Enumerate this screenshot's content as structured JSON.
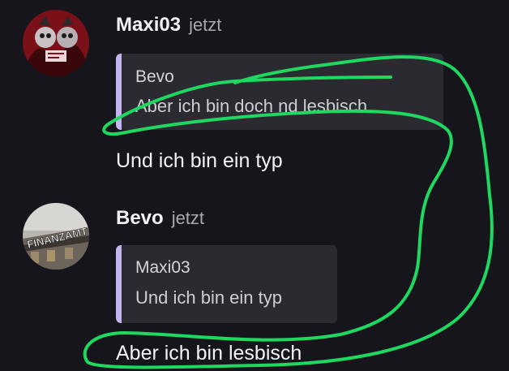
{
  "messages": [
    {
      "username": "Maxi03",
      "time": "jetzt",
      "avatar_icon": "red-cartoon-avatar-icon",
      "quote": {
        "author": "Bevo",
        "text": "Aber ich bin doch nd lesbisch"
      },
      "text": "Und ich bin ein typ"
    },
    {
      "username": "Bevo",
      "time": "jetzt",
      "avatar_icon": "finanzamt-building-avatar-icon",
      "avatar_text": "FINANZAMT",
      "quote": {
        "author": "Maxi03",
        "text": "Und ich bin ein typ"
      },
      "text": "Aber ich bin lesbisch"
    }
  ],
  "colors": {
    "background": "#17151c",
    "quote_background": "#2c2a31",
    "quote_bar": "#c6b4f2",
    "scribble": "#1fd860"
  }
}
